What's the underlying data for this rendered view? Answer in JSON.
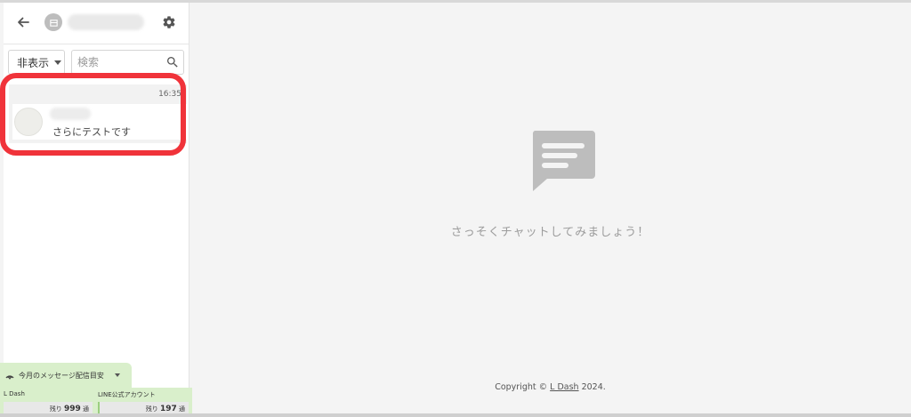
{
  "sidebar": {
    "back_icon": "arrow-left-icon",
    "store_icon": "store-icon",
    "settings_icon": "gear-icon",
    "filter": {
      "selected": "非表示"
    },
    "search": {
      "placeholder": "検索"
    },
    "conversations": [
      {
        "time": "16:35",
        "preview": "さらにテストです"
      }
    ]
  },
  "delivery_widget": {
    "title": "今月のメッセージ配信目安",
    "columns": [
      {
        "label": "L Dash",
        "remain_prefix": "残り",
        "remain_value": "999",
        "remain_unit": "通"
      },
      {
        "label": "LINE公式アカウント",
        "remain_prefix": "残り",
        "remain_value": "197",
        "remain_unit": "通"
      }
    ]
  },
  "main": {
    "empty_icon": "chat-bubble-icon",
    "empty_message": "さっそくチャットしてみましょう！",
    "footer": {
      "prefix": "Copyright © ",
      "link": "L Dash",
      "suffix": " 2024."
    }
  },
  "colors": {
    "highlight": "#f0333a",
    "widget_bg": "#d9efcb",
    "icon_gray": "#bdbdbd"
  }
}
